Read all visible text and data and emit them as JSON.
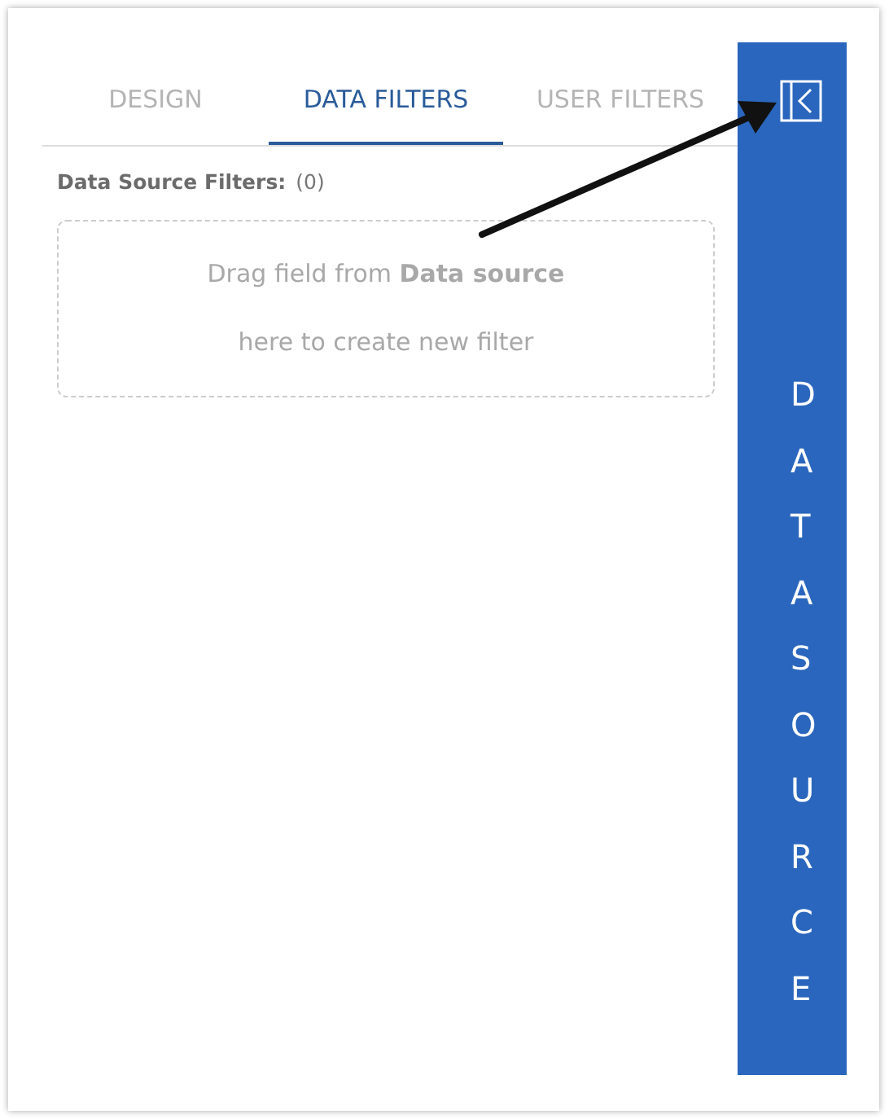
{
  "tabs": [
    {
      "label": "DESIGN",
      "selected": false
    },
    {
      "label": "DATA FILTERS",
      "selected": true
    },
    {
      "label": "USER FILTERS",
      "selected": false
    }
  ],
  "filters": {
    "label": "Data Source Filters:",
    "count": "(0)",
    "drop_hint": [
      "Drag field from **Data source**",
      "here to create new filter"
    ]
  },
  "side_panel": {
    "title": "DATA SOURCE"
  }
}
